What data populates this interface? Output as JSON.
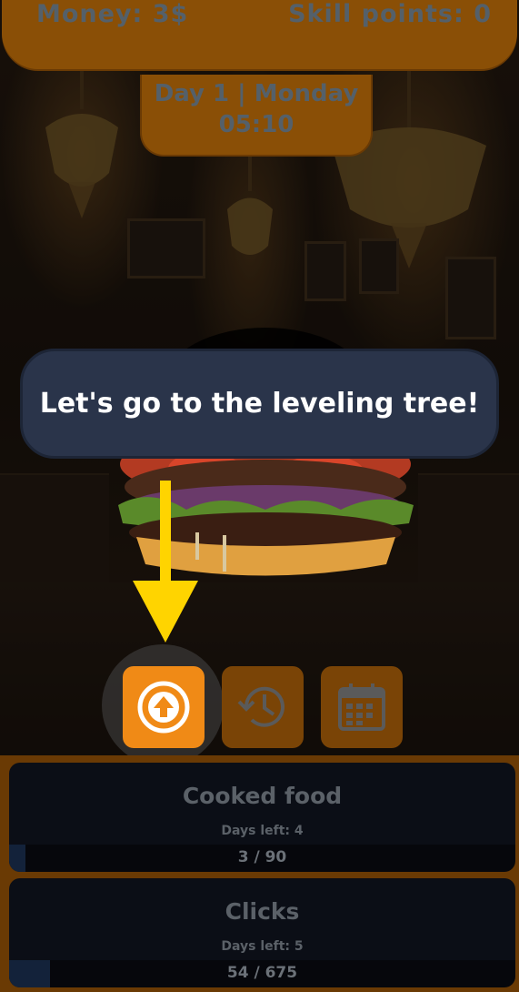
{
  "header": {
    "money": "Money: 3$",
    "skill_points": "Skill points: 0",
    "day": "Day 1 | Monday",
    "time": "05:10"
  },
  "tutorial": {
    "message": "Let's go to the leveling tree!"
  },
  "actions": [
    {
      "icon": "arrow-up-circle-icon",
      "highlighted": true
    },
    {
      "icon": "history-clock-icon",
      "highlighted": false
    },
    {
      "icon": "calendar-icon",
      "highlighted": false
    }
  ],
  "goals": [
    {
      "title": "Cooked food",
      "days_left": "Days left: 4",
      "progress_text": "3 / 90",
      "progress": 0.033
    },
    {
      "title": "Clicks",
      "days_left": "Days left: 5",
      "progress_text": "54 / 675",
      "progress": 0.08
    }
  ],
  "colors": {
    "accent_orange": "#f08a16",
    "dark_orange": "#8a4f06",
    "tooltip_bg": "#2a344a",
    "arrow_yellow": "#ffd400"
  }
}
